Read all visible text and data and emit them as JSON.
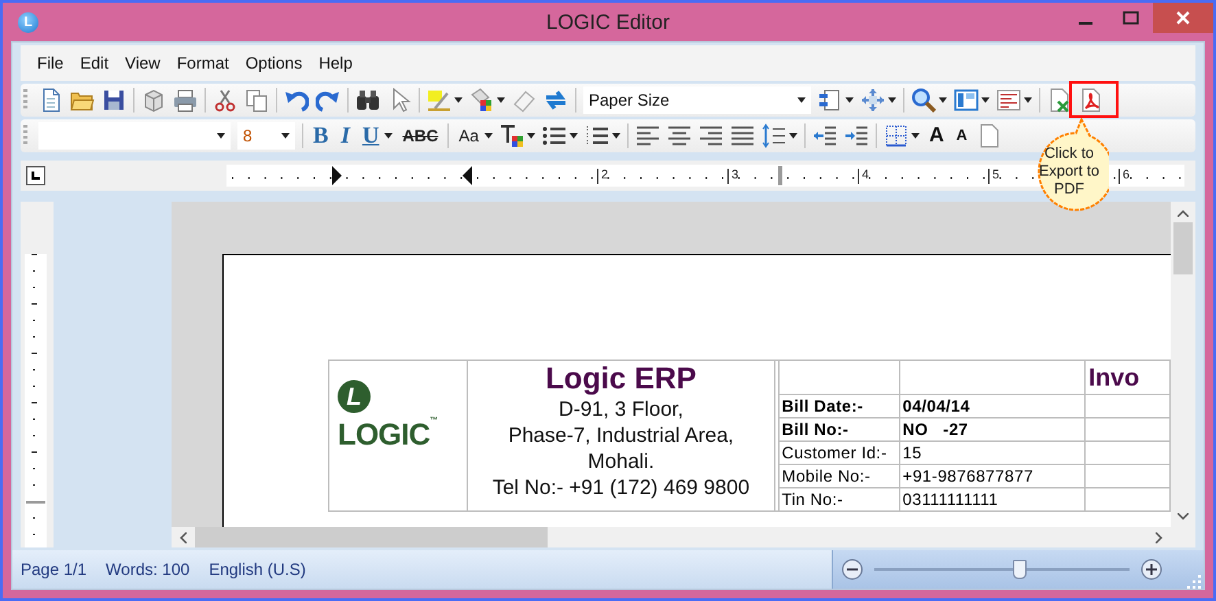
{
  "window": {
    "title": "LOGIC Editor",
    "icon_letter": "L"
  },
  "menu": [
    "File",
    "Edit",
    "View",
    "Format",
    "Options",
    "Help"
  ],
  "toolbar_1": {
    "paper_size": "Paper Size"
  },
  "toolbar_2": {
    "font_size": "8",
    "format_buttons": [
      {
        "label": "B",
        "kind": "bold"
      },
      {
        "label": "I",
        "kind": "italic"
      },
      {
        "label": "U",
        "kind": "underline"
      },
      {
        "label": "ABC",
        "kind": "strikethrough"
      },
      {
        "label": "Aa",
        "kind": "change_case"
      },
      {
        "label": "A",
        "kind": "grow_font"
      },
      {
        "label": "A",
        "kind": "shrink_font"
      }
    ]
  },
  "callout": {
    "text": "Click to Export to PDF"
  },
  "ruler": {
    "labels": [
      "2",
      "3",
      "4",
      "5",
      "6"
    ]
  },
  "document": {
    "logo": {
      "mark": "L",
      "text": "LOGIC",
      "tm": "™"
    },
    "company": {
      "name": "Logic ERP",
      "lines": [
        "D-91, 3 Floor,",
        "Phase-7, Industrial Area,",
        "Mohali.",
        "Tel No:- +91 (172) 469 9800"
      ]
    },
    "heading": "Invo",
    "bill_rows": [
      {
        "label": "Bill Date:-",
        "value": "04/04/14",
        "bold": true
      },
      {
        "label": "Bill No:-",
        "value": "NO   -27",
        "bold": true
      },
      {
        "label": "Customer Id:-",
        "value": "15",
        "bold": false
      },
      {
        "label": "Mobile No:-",
        "value": "+91-9876877877",
        "bold": false
      },
      {
        "label": "Tin No:-",
        "value": "03111111111",
        "bold": false
      }
    ]
  },
  "status_bar": {
    "items": [
      "Page 1/1",
      "Words: 100",
      "English (U.S)"
    ],
    "zoom": {
      "level": 0.57
    }
  }
}
